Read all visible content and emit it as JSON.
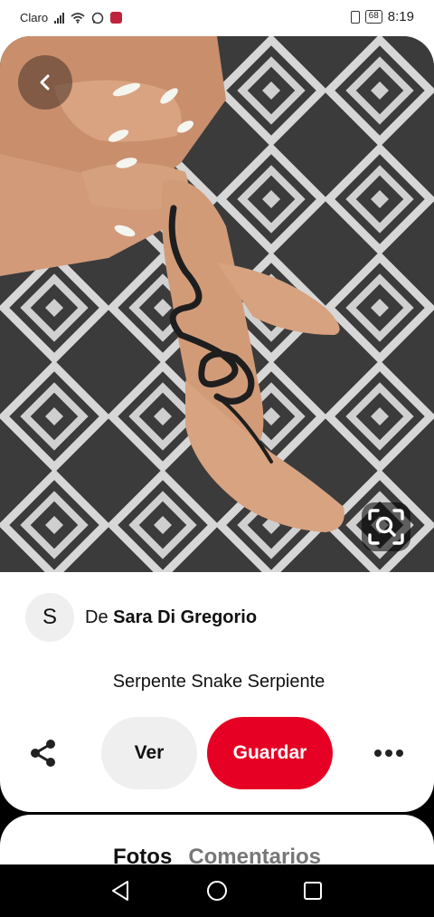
{
  "status_bar": {
    "carrier": "Claro",
    "battery": "68",
    "time": "8:19"
  },
  "pin": {
    "creator_initial": "S",
    "creator_prefix": "De",
    "creator_name": "Sara Di Gregorio",
    "title": "Serpente Snake Serpiente"
  },
  "actions": {
    "visit_label": "Ver",
    "save_label": "Guardar"
  },
  "tabs": [
    {
      "label": "Fotos"
    },
    {
      "label": "Comentarios"
    }
  ],
  "icons": {
    "back": "chevron-left-icon",
    "lens": "visual-search-icon",
    "share": "share-icon",
    "more": "more-horizontal-icon"
  },
  "colors": {
    "save_button": "#e60023",
    "visit_button": "#efefef"
  }
}
